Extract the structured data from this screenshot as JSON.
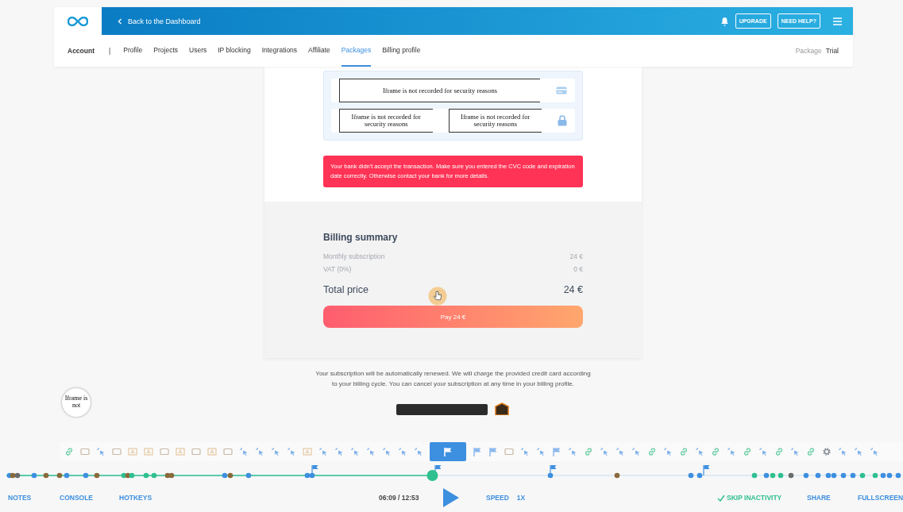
{
  "header": {
    "back_link": "Back to the Dashboard",
    "buttons": [
      "UPGRADE",
      "NEED HELP?"
    ]
  },
  "nav": {
    "title": "Account",
    "separator": "|",
    "tabs": [
      {
        "label": "Profile",
        "selected": false
      },
      {
        "label": "Projects",
        "selected": false
      },
      {
        "label": "Users",
        "selected": false
      },
      {
        "label": "IP blocking",
        "selected": false
      },
      {
        "label": "Integrations",
        "selected": false
      },
      {
        "label": "Affiliate",
        "selected": false
      },
      {
        "label": "Packages",
        "selected": true
      },
      {
        "label": "Billing profile",
        "selected": false
      }
    ],
    "package_label": "Package",
    "package_value": "Trial"
  },
  "payment_form": {
    "rows": [
      {
        "kind": "card",
        "fields": [
          "Iframe is not recorded for security reasons"
        ]
      },
      {
        "kind": "lock",
        "fields": [
          "Iframe is not recorded for security reasons",
          "Iframe is not recorded for security reasons"
        ]
      }
    ]
  },
  "error": "Your bank didn't accept the transaction. Make sure you entered the CVC code and expiration date correctly. Otherwise contact your bank for more details.",
  "billing_summary": {
    "title": "Billing summary",
    "lines": [
      {
        "label": "Monthly subscription",
        "value": "24 €"
      },
      {
        "label": "VAT (0%)",
        "value": "0 €"
      }
    ],
    "total_label": "Total price",
    "total_value": "24 €",
    "pay_button": "Pay 24 €"
  },
  "footer_note": "Your subscription will be automatically renewed. We will charge the provided credit card according to your billing cycle. You can cancel your subscription at any time in your billing profile.",
  "chat_widget": "Iframe is not",
  "player": {
    "events": [
      {
        "kind": "link",
        "selected": false
      },
      {
        "kind": "screen",
        "selected": false
      },
      {
        "kind": "click",
        "selected": false
      },
      {
        "kind": "screen",
        "selected": false
      },
      {
        "kind": "text",
        "selected": false
      },
      {
        "kind": "text",
        "selected": false
      },
      {
        "kind": "screen",
        "selected": false
      },
      {
        "kind": "text",
        "selected": false
      },
      {
        "kind": "screen",
        "selected": false
      },
      {
        "kind": "text",
        "selected": false
      },
      {
        "kind": "screen",
        "selected": false
      },
      {
        "kind": "click",
        "selected": false
      },
      {
        "kind": "click",
        "selected": false
      },
      {
        "kind": "click",
        "selected": false
      },
      {
        "kind": "click",
        "selected": false
      },
      {
        "kind": "text",
        "selected": false
      },
      {
        "kind": "click",
        "selected": false
      },
      {
        "kind": "click",
        "selected": false
      },
      {
        "kind": "click",
        "selected": false
      },
      {
        "kind": "click",
        "selected": false
      },
      {
        "kind": "click",
        "selected": false
      },
      {
        "kind": "click",
        "selected": false
      },
      {
        "kind": "click",
        "selected": false
      },
      {
        "kind": "flag",
        "selected": true
      },
      {
        "kind": "flag",
        "selected": false
      },
      {
        "kind": "flag",
        "selected": false
      },
      {
        "kind": "screen",
        "selected": false
      },
      {
        "kind": "click",
        "selected": false
      },
      {
        "kind": "click",
        "selected": false
      },
      {
        "kind": "flag",
        "selected": false
      },
      {
        "kind": "click",
        "selected": false
      },
      {
        "kind": "link",
        "selected": false
      },
      {
        "kind": "click",
        "selected": false
      },
      {
        "kind": "click",
        "selected": false
      },
      {
        "kind": "click",
        "selected": false
      },
      {
        "kind": "link",
        "selected": false
      },
      {
        "kind": "click",
        "selected": false
      },
      {
        "kind": "link",
        "selected": false
      },
      {
        "kind": "click",
        "selected": false
      },
      {
        "kind": "link",
        "selected": false
      },
      {
        "kind": "click",
        "selected": false
      },
      {
        "kind": "link",
        "selected": false
      },
      {
        "kind": "click",
        "selected": false
      },
      {
        "kind": "link",
        "selected": false
      },
      {
        "kind": "click",
        "selected": false
      },
      {
        "kind": "link",
        "selected": false
      },
      {
        "kind": "gear",
        "selected": false
      },
      {
        "kind": "click",
        "selected": false
      },
      {
        "kind": "click",
        "selected": false
      },
      {
        "kind": "click",
        "selected": false
      }
    ],
    "progress": {
      "level": 0.476
    },
    "controls": {
      "notes": "NOTES",
      "console": "CONSOLE",
      "hotkeys": "HOTKEYS",
      "time": "06:09 / 12:53",
      "speed_label": "SPEED",
      "speed_value": "1X",
      "skip": {
        "label": "SKIP INACTIVITY",
        "on": true
      },
      "share": "SHARE",
      "fullscreen": "FULLSCREEN"
    }
  }
}
